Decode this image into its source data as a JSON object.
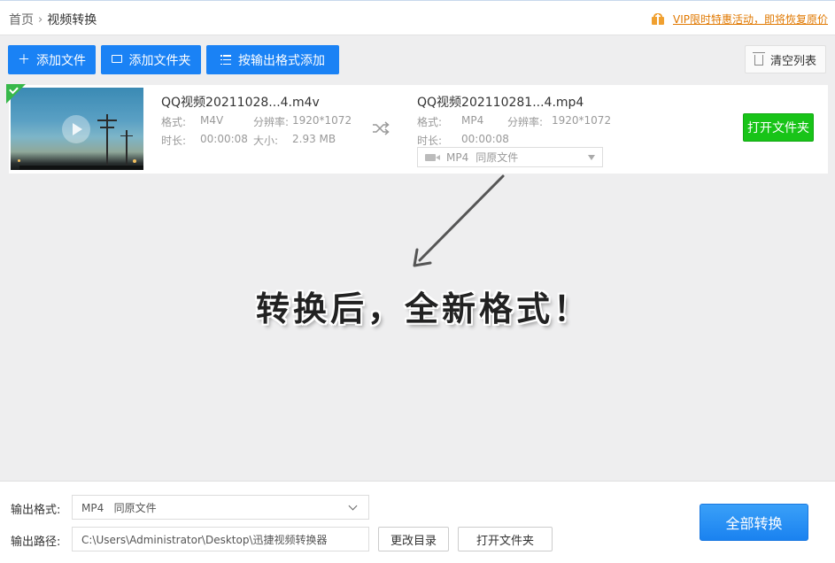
{
  "breadcrumb": {
    "home": "首页",
    "current": "视频转换"
  },
  "promo": {
    "text": "VIP限时特惠活动，即将恢复原价"
  },
  "toolbar": {
    "add_file": "添加文件",
    "add_folder": "添加文件夹",
    "add_by_format": "按输出格式添加",
    "clear_list": "清空列表"
  },
  "file": {
    "source": {
      "name": "QQ视频20211028...4.m4v",
      "format_label": "格式:",
      "format": "M4V",
      "resolution_label": "分辨率:",
      "resolution": "1920*1072",
      "duration_label": "时长:",
      "duration": "00:00:08",
      "size_label": "大小:",
      "size": "2.93 MB"
    },
    "target": {
      "name": "QQ视频202110281...4.mp4",
      "format_label": "格式:",
      "format": "MP4",
      "resolution_label": "分辨率:",
      "resolution": "1920*1072",
      "duration_label": "时长:",
      "duration": "00:00:08",
      "select_format": "MP4",
      "select_quality": "同原文件"
    },
    "open_folder": "打开文件夹"
  },
  "annotation": {
    "text": "转换后，全新格式！"
  },
  "bottom": {
    "format_label": "输出格式:",
    "format_value": "MP4   同原文件",
    "path_label": "输出路径:",
    "path_value": "C:\\Users\\Administrator\\Desktop\\迅捷视频转换器",
    "change_dir": "更改目录",
    "open_folder": "打开文件夹",
    "convert_all": "全部转换"
  },
  "colors": {
    "primary_blue": "#1a82f5",
    "open_green": "#18c418",
    "promo_orange": "#e07800",
    "check_green": "#37b84a"
  }
}
